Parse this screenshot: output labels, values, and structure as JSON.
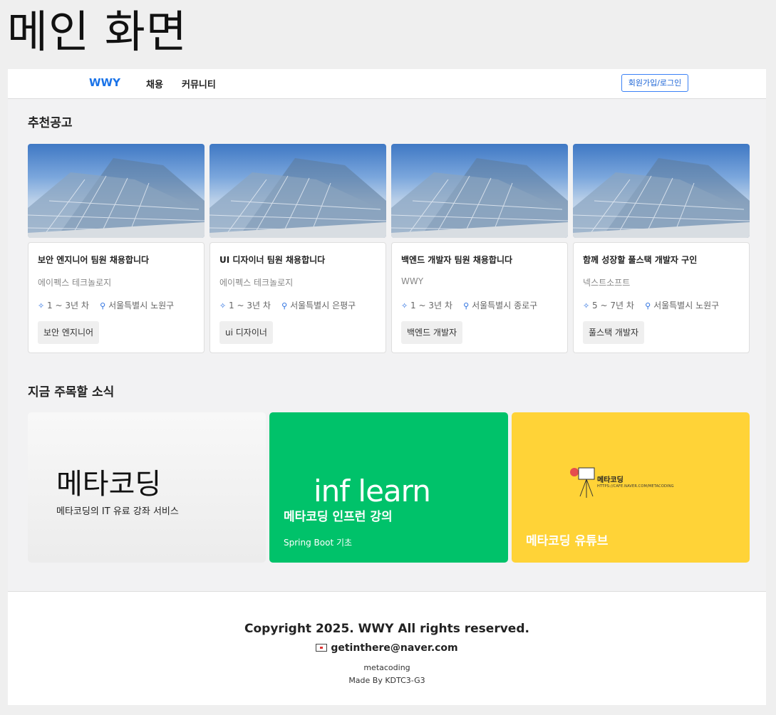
{
  "page_heading": "메인 화면",
  "nav": {
    "brand": "WWY",
    "items": [
      {
        "label": "채용"
      },
      {
        "label": "커뮤니티"
      }
    ],
    "auth_button": "회원가입/로그인"
  },
  "recommended": {
    "title": "추천공고",
    "cards": [
      {
        "title": "보안 엔지니어 팀원 채용합니다",
        "company": "에이펙스 테크놀로지",
        "career": "1 ~ 3년 차",
        "location": "서울특별시 노원구",
        "tag": "보안 엔지니어"
      },
      {
        "title": "UI 디자이너 팀원 채용합니다",
        "company": "에이펙스 테크놀로지",
        "career": "1 ~ 3년 차",
        "location": "서울특별시 은평구",
        "tag": "ui 디자이너"
      },
      {
        "title": "백엔드 개발자 팀원 채용합니다",
        "company": "WWY",
        "career": "1 ~ 3년 차",
        "location": "서울특별시 종로구",
        "tag": "백엔드 개발자"
      },
      {
        "title": "함께 성장할 풀스택 개발자 구인",
        "company": "넥스트소프트",
        "career": "5 ~ 7년 차",
        "location": "서울특별시 노원구",
        "tag": "풀스택 개발자"
      }
    ]
  },
  "news": {
    "title": "지금 주목할 소식",
    "items": [
      {
        "big": "메타코딩",
        "subtitle": "메타코딩의 IT 유료 강좌 서비스"
      },
      {
        "logo": "inf learn",
        "title": "메타코딩 인프런 강의",
        "subtitle": "Spring Boot 기초"
      },
      {
        "logo_text": "메타코딩",
        "logo_url": "HTTPS://CAFE.NAVER.COM/METACODING",
        "title": "메타코딩 유튜브"
      }
    ]
  },
  "footer": {
    "copyright": "Copyright 2025. WWY All rights reserved.",
    "email": "getinthere@naver.com",
    "org": "metacoding",
    "made_by": "Made By KDTC3-G3"
  },
  "colors": {
    "brand": "#1a73e8",
    "inflearn": "#00c26a",
    "youtube": "#ffd337",
    "page_bg": "#efefef"
  }
}
